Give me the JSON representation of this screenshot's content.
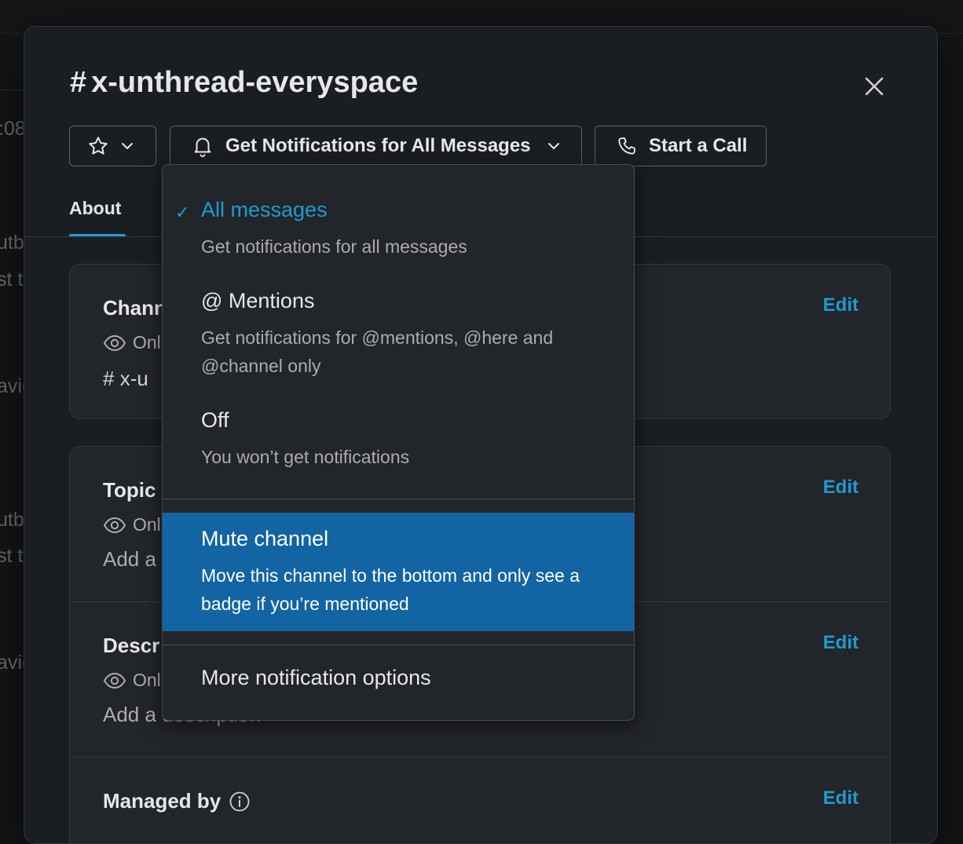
{
  "background": {
    "fragments": [
      ":08",
      "utb",
      "st t",
      "avig",
      "utb",
      "st t",
      "avig"
    ]
  },
  "modal": {
    "channel_hash": "#",
    "channel_name": "x-unthread-everyspace",
    "close_icon": "close-icon",
    "buttons": {
      "star_icon": "star-icon",
      "notifications_label": "Get Notifications for All Messages",
      "call_label": "Start a Call"
    },
    "tabs": [
      {
        "label": "About",
        "active": true
      }
    ],
    "channel_card": {
      "title": "Chann",
      "meta": "Onl",
      "hash": "#",
      "name": "x-u",
      "edit": "Edit"
    },
    "topic": {
      "title": "Topic",
      "meta": "Onl",
      "body": "Add a",
      "edit": "Edit"
    },
    "description": {
      "title": "Descr",
      "meta": "Onl",
      "body": "Add a",
      "body_tail": "description",
      "edit": "Edit"
    },
    "managed_by": {
      "title": "Managed by",
      "info_icon": "info-icon",
      "edit": "Edit"
    }
  },
  "dropdown": {
    "check_glyph": "✓",
    "options": [
      {
        "label": "All messages",
        "desc": "Get notifications for all messages",
        "checked": true
      },
      {
        "label": "@ Mentions",
        "desc": "Get notifications for @mentions, @here and @channel only"
      },
      {
        "label": "Off",
        "desc": "You won’t get notifications"
      },
      {
        "label": "Mute channel",
        "desc": "Move this channel to the bottom and only see a badge if you’re mentioned",
        "highlighted": true
      },
      {
        "label": "More notification options"
      }
    ]
  },
  "colors": {
    "accent": "#1d9bd1",
    "highlight": "#1264a3",
    "modal_bg": "#1a1d21",
    "card_bg": "#222529"
  }
}
